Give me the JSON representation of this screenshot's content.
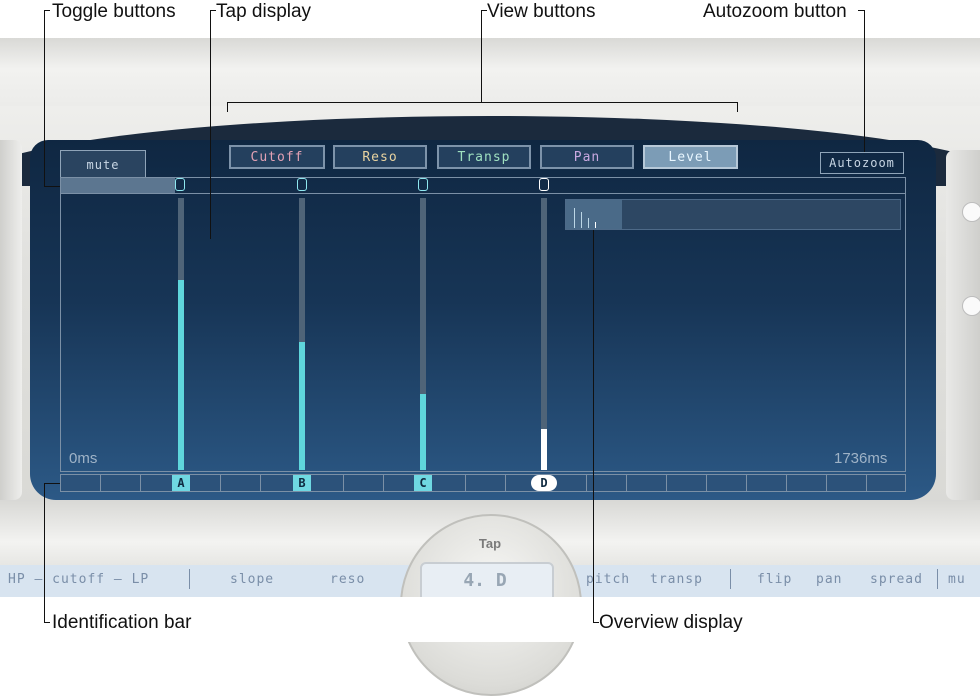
{
  "callouts": {
    "toggle_buttons": "Toggle buttons",
    "tap_display": "Tap display",
    "view_buttons": "View buttons",
    "autozoom_button": "Autozoom button",
    "identification_bar": "Identification bar",
    "overview_display": "Overview display"
  },
  "view_buttons": [
    "Cutoff",
    "Reso",
    "Transp",
    "Pan",
    "Level"
  ],
  "selected_view": "Level",
  "autozoom_label": "Autozoom",
  "mute_tab_label": "mute",
  "time_start": "0ms",
  "time_end": "1736ms",
  "taps": [
    {
      "id": "A",
      "level": 0.7
    },
    {
      "id": "B",
      "level": 0.47
    },
    {
      "id": "C",
      "level": 0.28
    },
    {
      "id": "D",
      "level": 0.15
    }
  ],
  "bottom_labels": {
    "cutoff": "HP – cutoff – LP",
    "slope": "slope",
    "reso": "reso",
    "pitch": "pitch",
    "transp": "transp",
    "flip": "flip",
    "pan": "pan",
    "spread": "spread",
    "mute": "mu"
  },
  "tap_title": "Tap",
  "tap_value": "4. D",
  "colors": {
    "screen_top": "#0f2742",
    "screen_bottom": "#2c5986",
    "level_bar": "#5fd6dc",
    "selected_tap": "#ffffff"
  }
}
